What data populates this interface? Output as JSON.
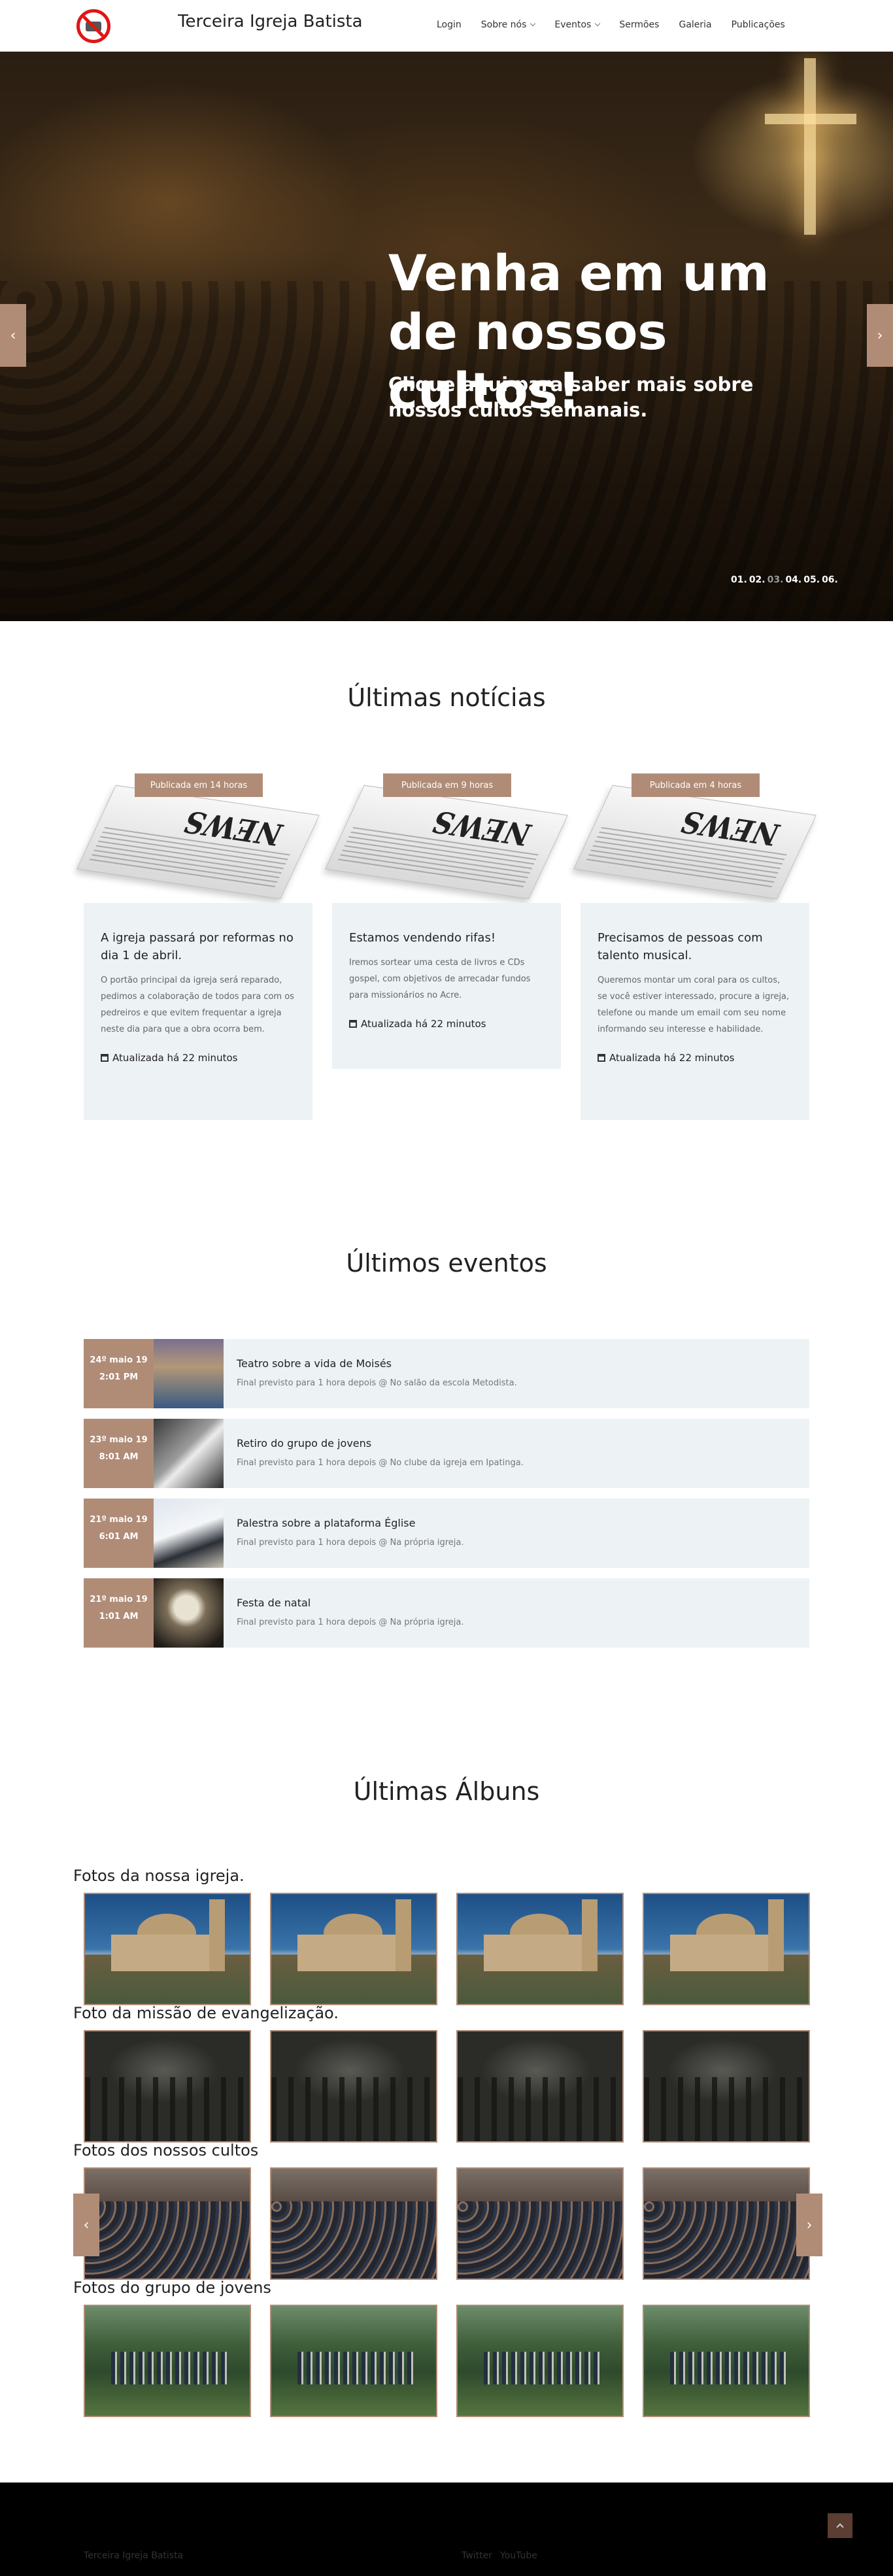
{
  "header": {
    "brand": "Terceira Igreja Batista",
    "nav": [
      {
        "label": "Login"
      },
      {
        "label": "Sobre nós"
      },
      {
        "label": "Eventos"
      },
      {
        "label": "Sermões"
      },
      {
        "label": "Galeria"
      },
      {
        "label": "Publicações"
      }
    ]
  },
  "hero": {
    "title": "Venha em um de nossos cultos!",
    "subtitle": "Clique aqui para saber mais sobre nossos cultos semanais.",
    "dots": [
      "01.",
      "02.",
      "03.",
      "04.",
      "05.",
      "06."
    ],
    "prev": "‹",
    "next": "›"
  },
  "news": {
    "title": "Últimas notícias",
    "items": [
      {
        "badge": "Publicada em 14 horas",
        "title": "A igreja passará por reformas no dia 1 de abril.",
        "text": "O portão principal da igreja será reparado, pedimos a colaboração de todos para com os pedreiros e que evitem frequentar a igreja neste dia para que a obra ocorra bem.",
        "updated": "Atualizada há 22 minutos"
      },
      {
        "badge": "Publicada em 9 horas",
        "title": "Estamos vendendo rifas!",
        "text": "Iremos sortear uma cesta de livros e CDs gospel, com objetivos de arrecadar fundos para missionários no Acre.",
        "updated": "Atualizada há 22 minutos"
      },
      {
        "badge": "Publicada em 4 horas",
        "title": "Precisamos de pessoas com talento musical.",
        "text": "Queremos montar um coral para os cultos, se você estiver interessado, procure a igreja, telefone ou mande um email com seu nome informando seu interesse e habilidade.",
        "updated": "Atualizada há 22 minutos"
      }
    ]
  },
  "events": {
    "title": "Últimos eventos",
    "items": [
      {
        "date": "24º maio 19 2:01 PM",
        "name": "Teatro sobre a vida de Moisés",
        "desc": "Final previsto para 1 hora depois @ No salão da escola Metodista."
      },
      {
        "date": "23º maio 19 8:01 AM",
        "name": "Retiro do grupo de jovens",
        "desc": "Final previsto para 1 hora depois @ No clube da igreja em Ipatinga."
      },
      {
        "date": "21º maio 19 6:01 AM",
        "name": "Palestra sobre a plataforma Église",
        "desc": "Final previsto para 1 hora depois @ Na própria igreja."
      },
      {
        "date": "21º maio 19 1:01 AM",
        "name": "Festa de natal",
        "desc": "Final previsto para 1 hora depois @ Na própria igreja."
      }
    ]
  },
  "albums": {
    "title": "Últimas Álbuns",
    "prev": "‹",
    "next": "›",
    "groups": [
      {
        "label": "Fotos da nossa igreja."
      },
      {
        "label": "Foto da missão de evangelização."
      },
      {
        "label": "Fotos dos nossos cultos"
      },
      {
        "label": "Fotos do grupo de jovens"
      }
    ]
  },
  "footer": {
    "name": "Terceira Igreja Batista",
    "social": [
      "Twitter",
      "YouTube"
    ]
  },
  "colors": {
    "accent": "#b08c77",
    "card_bg": "#edf2f5",
    "footer_bg": "#000000"
  }
}
